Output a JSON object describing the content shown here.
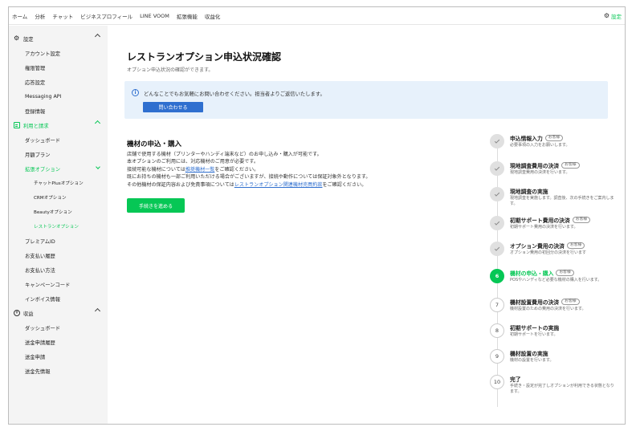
{
  "topnav": {
    "items": [
      "ホーム",
      "分析",
      "チャット",
      "ビジネスプロフィール",
      "LINE VOOM",
      "拡張機能",
      "収益化"
    ],
    "settings_label": "設定"
  },
  "sidebar": {
    "settings_head": "設定",
    "settings_items": [
      "アカウント設定",
      "権限管理",
      "応答設定",
      "Messaging API",
      "登録情報"
    ],
    "billing_head": "利用と請求",
    "billing_items": [
      "ダッシュボード",
      "月額プラン",
      "拡張オプション"
    ],
    "option_items": [
      "チャットPlusオプション",
      "CRMオプション",
      "Beautyオプション",
      "レストランオプション"
    ],
    "billing_items2": [
      "プレミアムID",
      "お支払い履歴",
      "お支払い方法",
      "キャンペーンコード",
      "インボイス情報"
    ],
    "revenue_head": "収益",
    "revenue_items": [
      "ダッシュボード",
      "送金申請履歴",
      "送金申請",
      "送金先情報"
    ]
  },
  "main": {
    "title": "レストランオプション申込状況確認",
    "subtitle": "オプション申込状況の確認ができます。",
    "info_message": "どんなことでもお気軽にお問い合わせください。担当者よりご返信いたします。",
    "contact_button": "問い合わせる",
    "section_title": "機材の申込・購入",
    "desc_line1": "店舗で使用する機材（プリンターやハンディ端末など）のお申し込み・購入が可能です。",
    "desc_line2": "本オプションのご利用には、対応機材のご用意が必要です。",
    "desc_line3_pre": "接続可能な機材については",
    "desc_line3_link": "推奨機材一覧",
    "desc_line3_post": "をご確認ください。",
    "desc_line4": "既にお持ちの機材も一部ご利用いただける場合がございますが、接続や動作については保証対象外となります。",
    "desc_line5_pre": "その他機材の保証内容および免責事項については",
    "desc_line5_link": "レストランオプション関連機材売買約款",
    "desc_line5_post": "をご確認ください。",
    "proceed_button": "手続きを進める"
  },
  "steps": [
    {
      "num": "",
      "title": "申込情報入力",
      "tag": "お客様",
      "desc": "必要事項の入力をお願いします。",
      "status": "done"
    },
    {
      "num": "",
      "title": "現地調査費用の決済",
      "tag": "お客様",
      "desc": "現地調査費用の決済を行います。",
      "status": "done"
    },
    {
      "num": "",
      "title": "現地調査の実施",
      "tag": "",
      "desc": "現地調査を実施します。調査後、次の手続きをご案内します。",
      "status": "done"
    },
    {
      "num": "",
      "title": "初期サポート費用の決済",
      "tag": "お客様",
      "desc": "初期サポート費用の決済を行います。",
      "status": "done"
    },
    {
      "num": "",
      "title": "オプション費用の決済",
      "tag": "お客様",
      "desc": "オプション費用の初回分の決済を行います",
      "status": "done"
    },
    {
      "num": "6",
      "title": "機材の申込・購入",
      "tag": "お客様",
      "desc": "POSやハンディなど必要な機材の購入を行います。",
      "status": "current"
    },
    {
      "num": "7",
      "title": "機材設置費用の決済",
      "tag": "お客様",
      "desc": "機材設置のための費用の決済を行います。",
      "status": "todo"
    },
    {
      "num": "8",
      "title": "初期サポートの実施",
      "tag": "",
      "desc": "初期サポートを行います。",
      "status": "todo"
    },
    {
      "num": "9",
      "title": "機材設置の実施",
      "tag": "",
      "desc": "機材の設置を行います。",
      "status": "todo"
    },
    {
      "num": "10",
      "title": "完了",
      "tag": "",
      "desc": "手続き・設定が完了しオプションが利用できる状態となります。",
      "status": "todo"
    }
  ],
  "colors": {
    "accent_green": "#06c755",
    "link_blue": "#2f6fcf",
    "info_bg": "#e7f1fb"
  }
}
